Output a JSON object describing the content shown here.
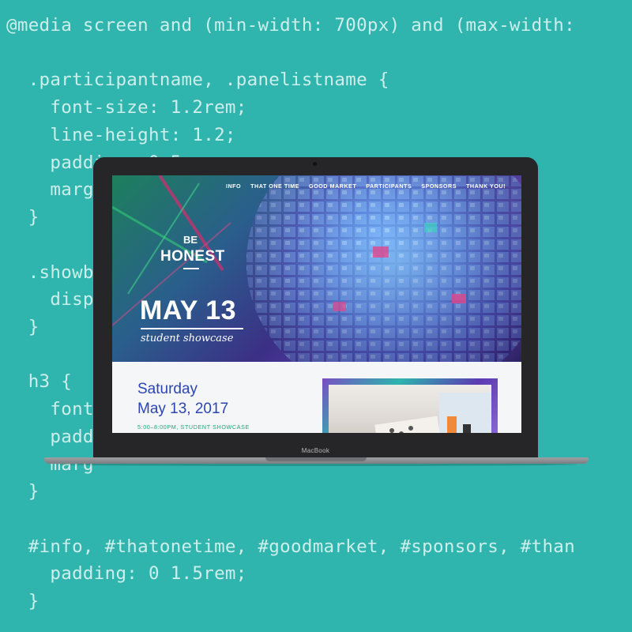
{
  "code": {
    "lines": [
      "@media screen and (min-width: 700px) and (max-width:",
      "  .participantname, .panelistname {",
      "    font-size: 1.2rem;",
      "    line-height: 1.2;",
      "    padding: 0 5",
      "    marg",
      "  }",
      "",
      "  .showb",
      "    disp",
      "  }",
      "",
      "  h3 {",
      "    font",
      "    padd",
      "    marg",
      "  }",
      "",
      "  #info, #thatonetime, #goodmarket, #sponsors, #than",
      "    padding: 0 1.5rem;",
      "  }"
    ]
  },
  "laptop": {
    "brand": "MacBook"
  },
  "site": {
    "nav": [
      "INFO",
      "THAT ONE TIME",
      "GOOD MARKET",
      "PARTICIPANTS",
      "SPONSORS",
      "THANK YOU!"
    ],
    "logo": {
      "line1": "BE",
      "line2": "HONEST"
    },
    "hero": {
      "date": "MAY 13",
      "subtitle": "student showcase"
    },
    "content": {
      "day": "Saturday",
      "date": "May 13, 2017",
      "time": "5:00–8:00PM, STUDENT SHOWCASE"
    }
  },
  "colors": {
    "background": "#2fb5ae",
    "code_text": "#cdeeea",
    "title_blue": "#2c45b4",
    "time_green": "#1fa27a"
  }
}
